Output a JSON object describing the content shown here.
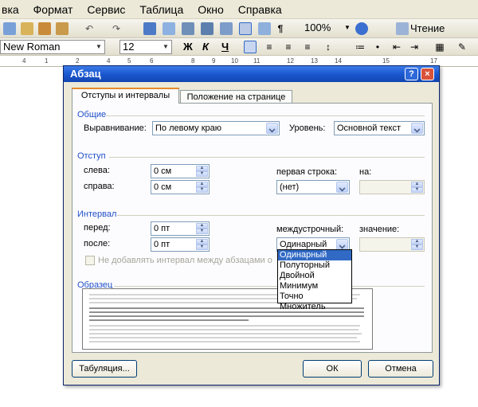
{
  "menubar": {
    "items": [
      "вка",
      "Формат",
      "Сервис",
      "Таблица",
      "Окно",
      "Справка"
    ]
  },
  "toolbar": {
    "zoom": "100%",
    "reading": "Чтение",
    "font_name": "New Roman",
    "font_size": "12",
    "bold": "Ж",
    "italic": "К",
    "underline": "Ч"
  },
  "ruler": {
    "labels": [
      "4",
      "1",
      "2",
      "4",
      "5",
      "6",
      "8",
      "9",
      "10",
      "11",
      "12",
      "13",
      "14",
      "15",
      "17"
    ]
  },
  "dialog": {
    "title": "Абзац",
    "help_button": "?",
    "close_button": "×",
    "tabs": [
      "Отступы и интервалы",
      "Положение на странице"
    ],
    "general": {
      "group_title": "Общие",
      "alignment_label": "Выравнивание:",
      "alignment_value": "По левому краю",
      "level_label": "Уровень:",
      "level_value": "Основной текст"
    },
    "indent": {
      "group_title": "Отступ",
      "left_label": "слева:",
      "left_value": "0 см",
      "right_label": "справа:",
      "right_value": "0 см",
      "first_line_label": "первая строка:",
      "first_line_value": "(нет)",
      "by_label": "на:"
    },
    "spacing": {
      "group_title": "Интервал",
      "before_label": "перед:",
      "before_value": "0 пт",
      "after_label": "после:",
      "after_value": "0 пт",
      "line_spacing_label": "междустрочный:",
      "line_spacing_value": "Одинарный",
      "value_label": "значение:",
      "no_space_checkbox": "Не добавлять интервал между абзацами о"
    },
    "line_spacing_options": [
      "Одинарный",
      "Полуторный",
      "Двойной",
      "Минимум",
      "Точно",
      "Множитель"
    ],
    "preview": {
      "group_title": "Образец"
    },
    "buttons": {
      "tabs_button": "Табуляция...",
      "ok": "ОК",
      "cancel": "Отмена"
    }
  },
  "colors": {
    "title_bar": "#1a58d0",
    "group_title": "#2150c8",
    "selection": "#316ac5",
    "active_tab_accent": "#e68b2c"
  }
}
